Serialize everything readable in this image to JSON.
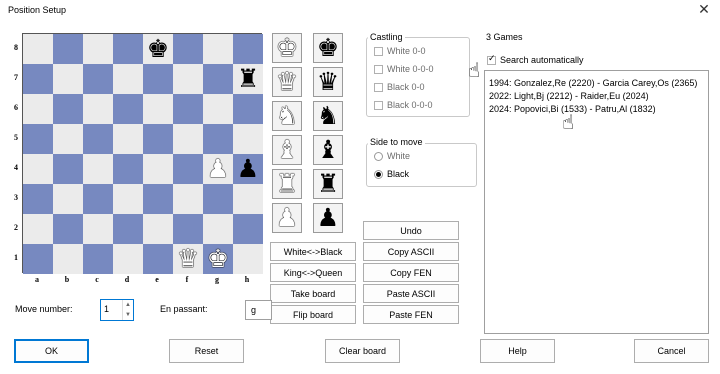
{
  "window": {
    "title": "Position Setup",
    "close_glyph": "✕"
  },
  "board": {
    "ranks": [
      "8",
      "7",
      "6",
      "5",
      "4",
      "3",
      "2",
      "1"
    ],
    "files": [
      "a",
      "b",
      "c",
      "d",
      "e",
      "f",
      "g",
      "h"
    ],
    "pieces": [
      {
        "square": "e8",
        "glyph": "♚",
        "color": "black",
        "name": "king"
      },
      {
        "square": "h7",
        "glyph": "♜",
        "color": "black",
        "name": "rook"
      },
      {
        "square": "g4",
        "glyph": "♟",
        "color": "white",
        "name": "pawn"
      },
      {
        "square": "h4",
        "glyph": "♟",
        "color": "black",
        "name": "pawn"
      },
      {
        "square": "f1",
        "glyph": "♛",
        "color": "white",
        "name": "queen"
      },
      {
        "square": "g1",
        "glyph": "♚",
        "color": "white",
        "name": "king"
      }
    ]
  },
  "palette": [
    {
      "piece": "king",
      "glyph": "♚"
    },
    {
      "piece": "queen",
      "glyph": "♛"
    },
    {
      "piece": "knight",
      "glyph": "♞"
    },
    {
      "piece": "bishop",
      "glyph": "♝"
    },
    {
      "piece": "rook",
      "glyph": "♜"
    },
    {
      "piece": "pawn",
      "glyph": "♟"
    }
  ],
  "buttons": {
    "white_black": "White<->Black",
    "king_queen": "King<->Queen",
    "take_board": "Take board",
    "flip_board": "Flip board",
    "undo": "Undo",
    "copy_ascii": "Copy ASCII",
    "copy_fen": "Copy FEN",
    "paste_ascii": "Paste ASCII",
    "paste_fen": "Paste FEN",
    "ok": "OK",
    "reset": "Reset",
    "clear_board": "Clear board",
    "help": "Help",
    "cancel": "Cancel"
  },
  "castling": {
    "label": "Castling",
    "options": [
      "White 0-0",
      "White 0-0-0",
      "Black 0-0",
      "Black 0-0-0"
    ]
  },
  "side_to_move": {
    "label": "Side to move",
    "options": [
      "White",
      "Black"
    ],
    "selected": "Black"
  },
  "games": {
    "count_label": "3 Games",
    "search_auto_label": "Search automatically",
    "search_auto_checked": true,
    "items": [
      "1994: Gonzalez,Re (2220) - Garcia Carey,Os (2365)",
      "2022: Light,Bj (2212) - Raider,Eu (2024)",
      "2024: Popovici,Bi (1533) - Patru,Al (1832)"
    ]
  },
  "move_number": {
    "label": "Move number:",
    "value": "1"
  },
  "en_passant": {
    "label": "En passant:",
    "value": "g"
  },
  "icons": {
    "cursor": "hand-pointer-icon",
    "checkmark": "✓",
    "spin_up": "▲",
    "spin_down": "▼"
  },
  "colors": {
    "light_square": "#ebebeb",
    "dark_square": "#7789c0",
    "accent": "#0078d4"
  }
}
